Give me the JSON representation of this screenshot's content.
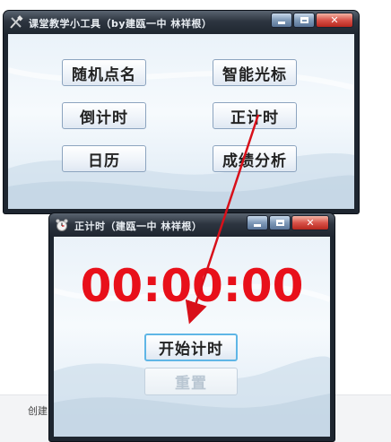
{
  "main_window": {
    "title": "课堂教学小工具（by建瓯一中 林祥根）",
    "buttons": {
      "random_roll": "随机点名",
      "smart_cursor": "智能光标",
      "countdown": "倒计时",
      "count_up": "正计时",
      "calendar": "日历",
      "grade_analysis": "成绩分析"
    }
  },
  "timer_window": {
    "title": "正计时（建瓯一中 林祥根）",
    "time_display": "00:00:00",
    "start_button": "开始计时",
    "reset_button": "重置"
  },
  "window_controls": {
    "close_glyph": "✕"
  },
  "background": {
    "partial_text": "创建"
  },
  "colors": {
    "timer_digits": "#e8101a",
    "arrow": "#d8101a",
    "focus_border": "#5fb6e6"
  },
  "icons": {
    "main_window_icon": "tools-icon",
    "timer_window_icon": "alarm-clock-icon"
  }
}
